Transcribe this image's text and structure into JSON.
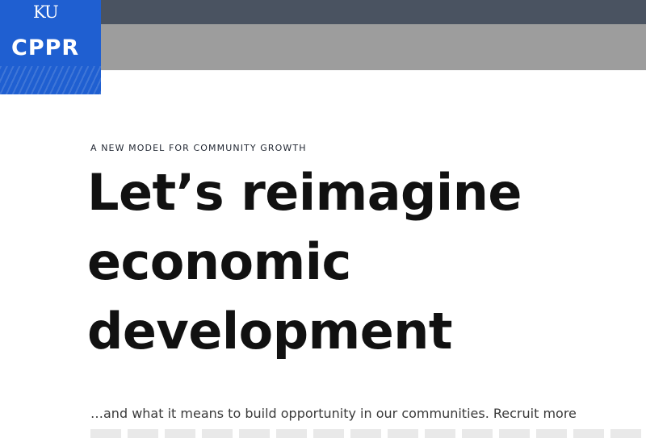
{
  "header": {
    "logo_mark": "KU",
    "logo_name": "CPPR"
  },
  "hero": {
    "eyebrow": "A NEW MODEL FOR COMMUNITY GROWTH",
    "headline_lines": [
      "Let’s reimagine",
      "economic",
      "development"
    ],
    "lede": "…and what it means to build opportunity in our communities. Recruit more"
  },
  "colors": {
    "topbar": "#4a5361",
    "subbar": "#9d9d9d",
    "brand_blue": "#1f5fd1",
    "text": "#111111"
  }
}
